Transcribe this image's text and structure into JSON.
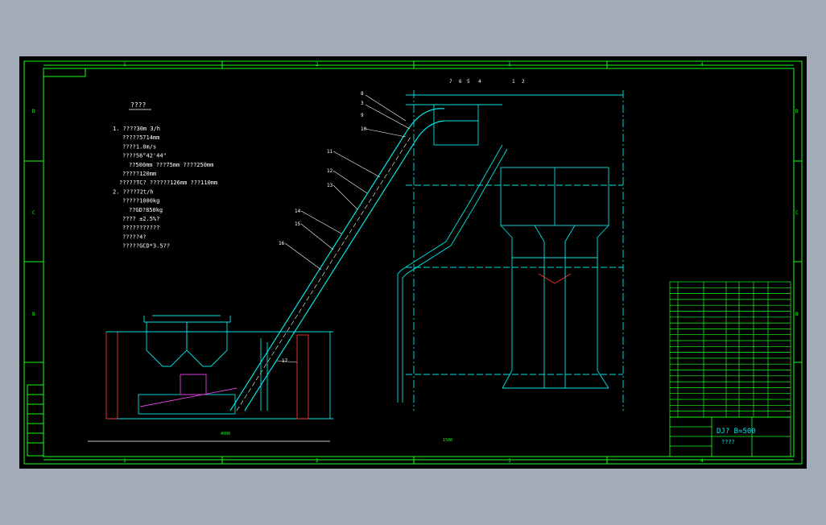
{
  "colors": {
    "background": "#a3aab8",
    "sheet": "#000000",
    "frame": "#19ff19",
    "structure": "#00e5e5",
    "text": "#ffffff",
    "accent_red": "#ff3030",
    "accent_magenta": "#e040e0"
  },
  "frame": {
    "columns": [
      "1",
      "2",
      "3",
      "4"
    ],
    "rows": [
      "D",
      "C",
      "B"
    ]
  },
  "notes": {
    "heading": "????",
    "lines": [
      "1. ????30m  3/h",
      "?????5714mm",
      "????1.0m/s",
      "????56°42'44\"",
      "??500mm ???75mm ????250mm",
      "?????120mm",
      "?????TC? ??????126mm ???110mm",
      "2. ????72t/h",
      "?????1000kg",
      "??GD?850kg",
      "????  ±2.5%?",
      "???????????",
      "?????4?",
      "?????GCD*3.5??"
    ]
  },
  "callouts": [
    "8",
    "3",
    "9",
    "10",
    "11",
    "12",
    "13",
    "14",
    "15",
    "16",
    "17",
    "7",
    "6",
    "5",
    "4",
    "1",
    "2"
  ],
  "title_block": {
    "title": "DJ? B=500",
    "subtitle": "????"
  },
  "dimension_labels": [
    "4000",
    "17",
    "1500"
  ]
}
